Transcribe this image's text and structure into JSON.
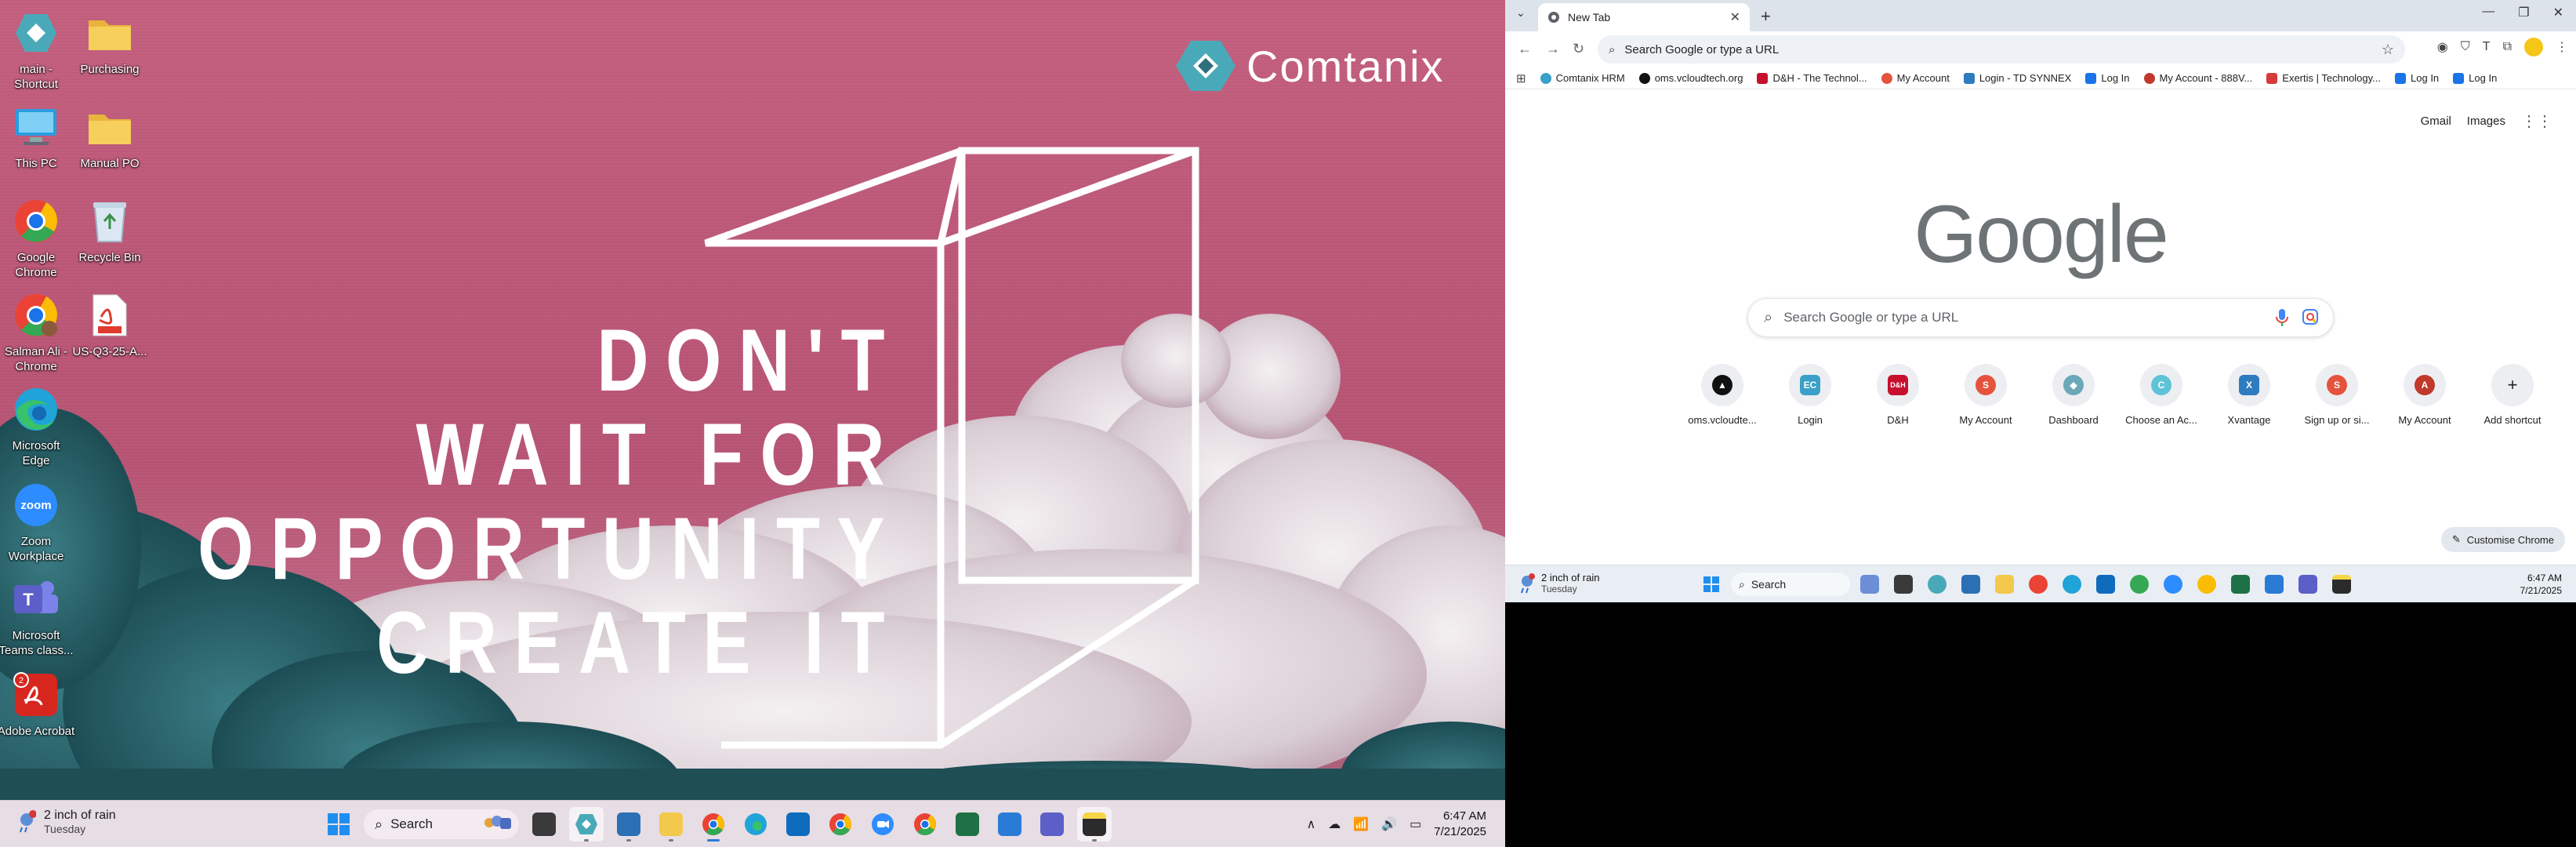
{
  "wallpaper": {
    "brand": "Comtanix",
    "quote_lines": [
      "DON'T",
      "WAIT FOR",
      "OPPORTUNITY",
      "CREATE IT"
    ]
  },
  "desktop_icons": [
    {
      "label": "main - Shortcut",
      "icon": "app-shortcut-icon",
      "color": "#3aa0c8"
    },
    {
      "label": "Purchasing",
      "icon": "folder-icon",
      "color": "#f2c94c"
    },
    {
      "label": "This PC",
      "icon": "this-pc-icon",
      "color": "#2b9be0"
    },
    {
      "label": "Manual PO",
      "icon": "folder-icon",
      "color": "#f2c94c"
    },
    {
      "label": "Google Chrome",
      "icon": "chrome-icon",
      "color": "#ea4335"
    },
    {
      "label": "Recycle Bin",
      "icon": "recycle-bin-icon",
      "color": "#d8e6f2"
    },
    {
      "label": "Salman Ali - Chrome",
      "icon": "chrome-icon",
      "color": "#ea4335"
    },
    {
      "label": "US-Q3-25-A...",
      "icon": "pdf-icon",
      "color": "#e03a2f"
    },
    {
      "label": "Microsoft Edge",
      "icon": "edge-icon",
      "color": "#1fa3d9"
    },
    {
      "label": "Zoom Workplace",
      "icon": "zoom-icon",
      "color": "#2d8cff"
    },
    {
      "label": "Microsoft Teams class...",
      "icon": "teams-icon",
      "color": "#5b5fc7"
    },
    {
      "label": "Adobe Acrobat",
      "icon": "acrobat-icon",
      "color": "#d7261e"
    }
  ],
  "taskbar_left": {
    "weather_text": "2 inch of rain",
    "weather_day": "Tuesday",
    "weather_badge": "2",
    "search_label": "Search",
    "time": "6:47 AM",
    "date": "7/21/2025",
    "apps": [
      {
        "name": "start-icon",
        "color": "#1f8ef1"
      },
      {
        "name": "widgets-icon",
        "color": "#9aa7c4"
      },
      {
        "name": "terminal-icon",
        "color": "#3a3a3a"
      },
      {
        "name": "app-shortcut-icon",
        "color": "#3aa0c8"
      },
      {
        "name": "calculator-icon",
        "color": "#2b6fb5"
      },
      {
        "name": "file-explorer-icon",
        "color": "#f2c94c"
      },
      {
        "name": "chrome-icon",
        "color": "#ea4335"
      },
      {
        "name": "edge-icon",
        "color": "#1fa3d9"
      },
      {
        "name": "outlook-icon",
        "color": "#0f6cbd"
      },
      {
        "name": "chrome-profile-icon",
        "color": "#34a853"
      },
      {
        "name": "zoom-icon",
        "color": "#2d8cff"
      },
      {
        "name": "chrome-icon",
        "color": "#fbbc05"
      },
      {
        "name": "excel-icon",
        "color": "#1e7145"
      },
      {
        "name": "remote-desktop-icon",
        "color": "#2a7bd6"
      },
      {
        "name": "teams-icon",
        "color": "#5b5fc7"
      },
      {
        "name": "sticky-notes-icon",
        "color": "#f6d548"
      }
    ]
  },
  "browser": {
    "tab_title": "New Tab",
    "omnibox_placeholder": "Search Google or type a URL",
    "bookmarks": [
      {
        "label": "Comtanix HRM",
        "color": "#3aa0c8"
      },
      {
        "label": "oms.vcloudtech.org",
        "color": "#111111"
      },
      {
        "label": "D&H - The Technol...",
        "color": "#c8102e"
      },
      {
        "label": "My Account",
        "color": "#e5533d"
      },
      {
        "label": "Login - TD SYNNEX",
        "color": "#2f7bbf"
      },
      {
        "label": "Log In",
        "color": "#1a73e8"
      },
      {
        "label": "My Account - 888V...",
        "color": "#c0392b"
      },
      {
        "label": "Exertis | Technology...",
        "color": "#d63a3a"
      },
      {
        "label": "Log In",
        "color": "#1a73e8"
      },
      {
        "label": "Log In",
        "color": "#1a73e8"
      }
    ],
    "top_links": [
      "Gmail",
      "Images"
    ],
    "google_logo": "Google",
    "search_placeholder": "Search Google or type a URL",
    "shortcuts": [
      {
        "label": "oms.vcloudte...",
        "color": "#111111",
        "glyph": "▲"
      },
      {
        "label": "Login",
        "color": "#3aa0c8",
        "glyph": "EC"
      },
      {
        "label": "D&H",
        "color": "#c8102e",
        "glyph": "D&H"
      },
      {
        "label": "My Account",
        "color": "#e5533d",
        "glyph": "S"
      },
      {
        "label": "Dashboard",
        "color": "#6aa8b8",
        "glyph": "◆"
      },
      {
        "label": "Choose an Ac...",
        "color": "#5fc3d7",
        "glyph": "C"
      },
      {
        "label": "Xvantage",
        "color": "#2f7bbf",
        "glyph": "X"
      },
      {
        "label": "Sign up or si...",
        "color": "#e5533d",
        "glyph": "S"
      },
      {
        "label": "My Account",
        "color": "#c0392b",
        "glyph": "A"
      },
      {
        "label": "Add shortcut",
        "color": "#eceef2",
        "glyph": "+"
      }
    ],
    "customise_label": "Customise Chrome"
  },
  "taskbar_right": {
    "weather_text": "2 inch of rain",
    "weather_day": "Tuesday",
    "search_label": "Search",
    "time": "6:47 AM",
    "date": "7/21/2025"
  }
}
